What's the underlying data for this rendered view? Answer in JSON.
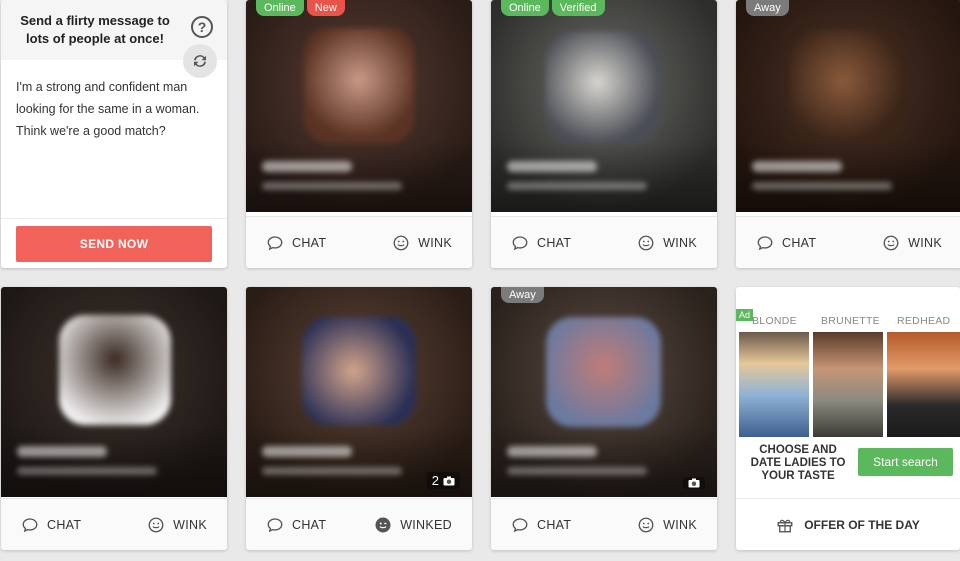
{
  "message_card": {
    "title": "Send a flirty message to lots of people at once!",
    "text": "I'm a strong and confident man looking for the same in a woman. Think we're a good match?",
    "send_label": "SEND NOW"
  },
  "actions": {
    "chat": "CHAT",
    "wink": "WINK",
    "winked": "WINKED"
  },
  "profiles": [
    {
      "badges": [
        "Online",
        "New"
      ],
      "wink_label": "WINK",
      "photo_count": ""
    },
    {
      "badges": [
        "Online",
        "Verified"
      ],
      "wink_label": "WINK",
      "photo_count": ""
    },
    {
      "badges": [
        "Away"
      ],
      "wink_label": "WINK",
      "photo_count": ""
    },
    {
      "badges": [],
      "wink_label": "WINK",
      "photo_count": ""
    },
    {
      "badges": [],
      "wink_label": "WINKED",
      "photo_count": "2"
    },
    {
      "badges": [
        "Away"
      ],
      "wink_label": "WINK",
      "photo_count": ""
    }
  ],
  "ad": {
    "tag": "Ad",
    "labels": [
      "BLONDE",
      "BRUNETTE",
      "REDHEAD"
    ],
    "caption": "CHOOSE AND DATE LADIES TO YOUR TASTE",
    "button": "Start search",
    "offer": "OFFER OF THE DAY"
  },
  "colors": {
    "send_button": "#f0625a",
    "online": "#5cb85c",
    "new": "#e8534a",
    "away": "#7b7b7b",
    "ad_button": "#5cb85c"
  }
}
